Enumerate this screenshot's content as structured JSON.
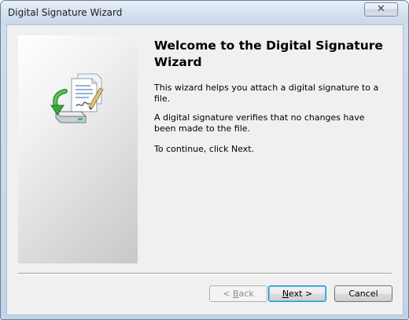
{
  "window": {
    "title": "Digital Signature Wizard",
    "close_glyph": "✕"
  },
  "main": {
    "heading": "Welcome to the Digital Signature Wizard",
    "paragraphs": [
      "This wizard helps you attach a digital signature to a file.",
      "A digital signature verifies that no changes have been made to the file.",
      "To continue, click Next."
    ],
    "icon": "certificate-drive-icon"
  },
  "buttons": {
    "back": {
      "prefix": "< ",
      "mnemonic": "B",
      "rest": "ack",
      "enabled": false
    },
    "next": {
      "mnemonic": "N",
      "rest": "ext >",
      "enabled": true
    },
    "cancel": {
      "label": "Cancel",
      "enabled": true
    }
  },
  "colors": {
    "accent_default_button": "#3c7fb1",
    "window_frame": "#c4d4e8",
    "content_bg": "#f0f0f0"
  }
}
